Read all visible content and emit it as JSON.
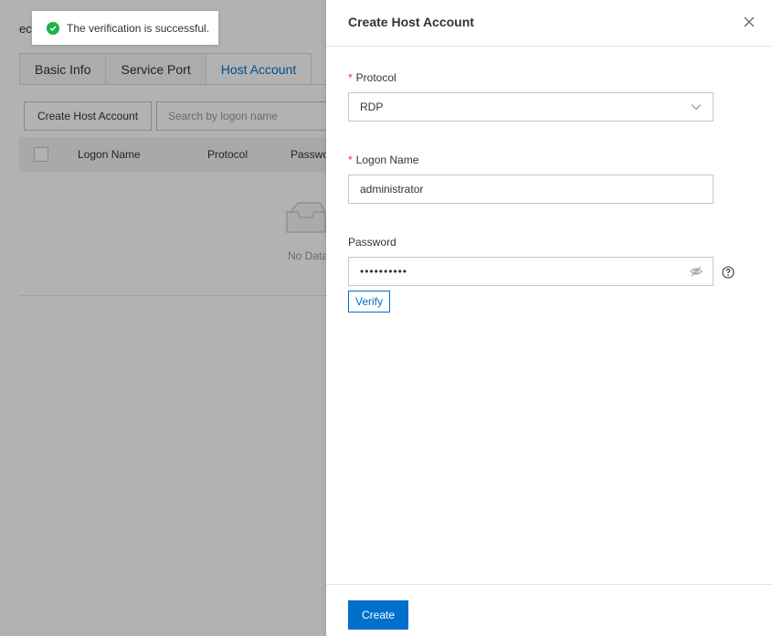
{
  "background": {
    "title_fragment": "ec",
    "tabs": [
      {
        "label": "Basic Info"
      },
      {
        "label": "Service Port"
      },
      {
        "label": "Host Account"
      }
    ],
    "create_host_account_button": "Create Host Account",
    "search_placeholder": "Search by logon name",
    "table_headers": [
      "Logon Name",
      "Protocol",
      "Passwo"
    ],
    "empty_text": "No Data"
  },
  "toast": {
    "message": "The verification is successful.",
    "status_color": "#1db24a"
  },
  "drawer": {
    "title": "Create Host Account",
    "protocol": {
      "label": "Protocol",
      "value": "RDP"
    },
    "logon_name": {
      "label": "Logon Name",
      "value": "administrator"
    },
    "password": {
      "label": "Password",
      "value": "••••••••••"
    },
    "verify_label": "Verify",
    "create_label": "Create",
    "accent_color": "#0070cc"
  }
}
